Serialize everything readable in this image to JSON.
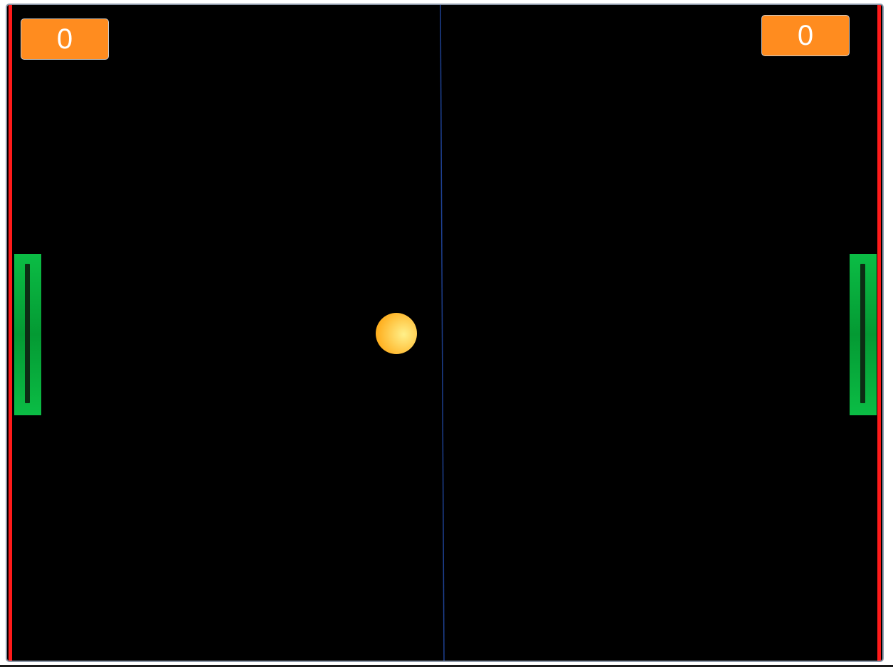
{
  "game": {
    "colors": {
      "background": "#000000",
      "wall": "#ff1a1a",
      "net": "#1d3f8f",
      "paddle": "#0bbd45",
      "paddle_dark": "#049a33",
      "ball": "#ffb020",
      "ball_highlight": "#fff08a",
      "score_box": "#ff8c1f"
    },
    "scores": {
      "left": "0",
      "right": "0"
    }
  }
}
